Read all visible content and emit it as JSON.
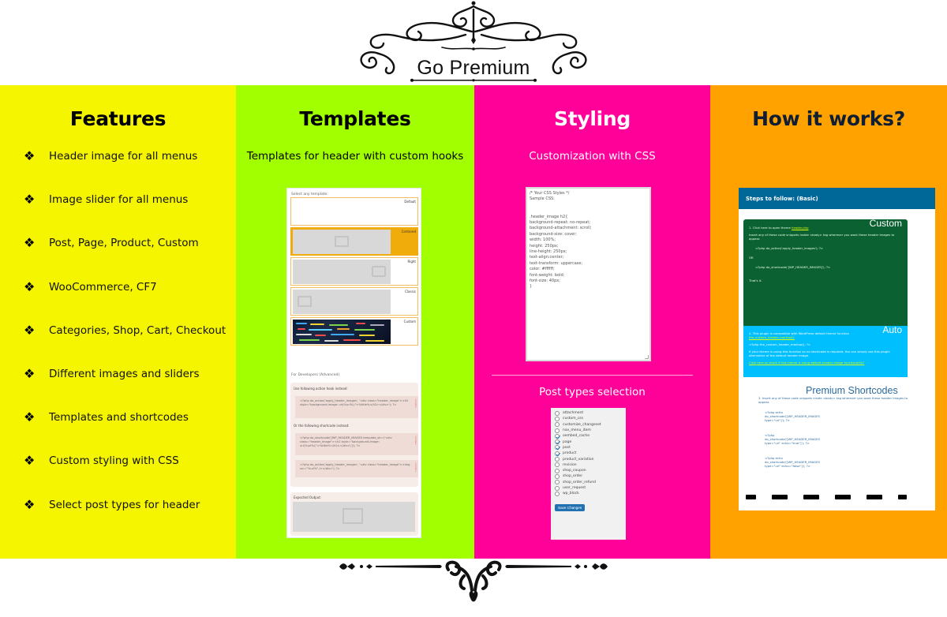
{
  "header": {
    "title": "Go Premium",
    "ornament_icon": "flourish-ornament-icon"
  },
  "colors": {
    "features_bg": "#f5f500",
    "templates_bg": "#a2ff00",
    "styling_bg": "#ff0099",
    "how_bg": "#ffa200",
    "wp_blue": "#2271b1",
    "steps_header": "#006799",
    "custom_card": "#0b6131",
    "auto_card": "#00bfff"
  },
  "features": {
    "title": "Features",
    "bullet_icon": "❖",
    "items": [
      "Header image for all menus",
      "Image slider for all menus",
      "Post, Page, Product, Custom",
      "WooCommerce, CF7",
      "Categories, Shop, Cart, Checkout",
      "Different images and sliders",
      "Templates and shortcodes",
      "Custom styling with CSS",
      "Select post types for header"
    ]
  },
  "templates": {
    "title": "Templates",
    "subtitle": "Templates for header with custom hooks",
    "mock": {
      "select_label": "Select any template:",
      "options": [
        {
          "name": "Default",
          "selected": false
        },
        {
          "name": "Centered",
          "selected": true
        },
        {
          "name": "Right",
          "selected": false
        },
        {
          "name": "Classic",
          "selected": false
        },
        {
          "name": "Custom",
          "selected": false
        }
      ],
      "dev_label": "For Developers (Advanced)",
      "action_hook_label": "Use following action hook instead:",
      "code1": "<?php do_action('apply_header_images', '<div class=\"header_image\"><h2 style=\"background-image: url(%url%);\">%title%</h2></div>'); ?>",
      "shortcode_label": "Or the following shortcode instead:",
      "code2": "<?php do_shortcode('[WP_HEADER_IMAGES template_str=\\'<div class=\"header_image\"><h2 style=\"background-image: url(%url%);\">%title%</h2></div>\\']'); ?>",
      "code3": "<?php do_action('apply_header_images', '<div class=\"header_image\"><img src=\"%url%\" /></div>'); ?>",
      "code_tag": "<code>",
      "expected_label": "Expected Output:"
    }
  },
  "styling": {
    "title": "Styling",
    "subtitle": "Customization with CSS",
    "css_lines": [
      "/* Your CSS Styles */",
      "Sample CSS:",
      "",
      "",
      ".header_image h2{",
      "background-repeat: no-repeat;",
      "background-attachment: scroll;",
      "background-size: cover;",
      "width: 100%;",
      "height: 250px;",
      "line-height: 250px;",
      "text-align:center;",
      "text-transform: uppercase;",
      "color: #ffffff;",
      "font-weight: bold;",
      "font-size: 40px;",
      "}"
    ],
    "post_types_title": "Post types selection",
    "post_types": [
      {
        "name": "attachment",
        "checked": false
      },
      {
        "name": "custom_css",
        "checked": false
      },
      {
        "name": "customize_changeset",
        "checked": false
      },
      {
        "name": "nav_menu_item",
        "checked": false
      },
      {
        "name": "oembed_cache",
        "checked": true
      },
      {
        "name": "page",
        "checked": true
      },
      {
        "name": "post",
        "checked": true
      },
      {
        "name": "product",
        "checked": true
      },
      {
        "name": "product_variation",
        "checked": false
      },
      {
        "name": "revision",
        "checked": false
      },
      {
        "name": "shop_coupon",
        "checked": false
      },
      {
        "name": "shop_order",
        "checked": false
      },
      {
        "name": "shop_order_refund",
        "checked": false
      },
      {
        "name": "user_request",
        "checked": false
      },
      {
        "name": "wp_block",
        "checked": false
      }
    ],
    "save_label": "Save Changes"
  },
  "how": {
    "title": "How it works?",
    "steps_header": "Steps to follow: (Basic)",
    "custom": {
      "badge": "Custom",
      "step_prefix": "1. Click here to open theme ",
      "step_link": "header.php",
      "instr": "Insert any of these code snippets inside <body> tag wherever you want these header images to appear.",
      "code1": "<?php do_action('apply_header_images'); ?>",
      "or": "OR",
      "code2": "<?php do_shortcode('[WP_HEADER_IMAGES]'); ?>",
      "done": "That's it."
    },
    "auto": {
      "badge": "Auto",
      "step": "2. This plugin is compatible with WordPress default theme function",
      "fn_link": "the_custom_header_markup().",
      "code": "<?php the_custom_header_markup(); ?>",
      "note": "If your theme is using this function so no shortcode is required. You can simply use this plugin alternative of the default header image.",
      "check_link": "Click here to check if this theme is using default header image functionality?"
    },
    "premium": {
      "title": "Premium Shortcodes",
      "instr": "3. Insert any of these code snippets inside <body> tag wherever you want these header images to appear.",
      "codes": [
        "<?php echo do_shortcode('[WP_HEADER_IMAGES type=\"url\"]'); ?>",
        "<?php do_shortcode('[WP_HEADER_IMAGES type=\"url\" echo=\"true\"]'); ?>",
        "<?php echo do_shortcode('[WP_HEADER_IMAGES type=\"url\" echo=\"false\"]'); ?>"
      ]
    }
  }
}
